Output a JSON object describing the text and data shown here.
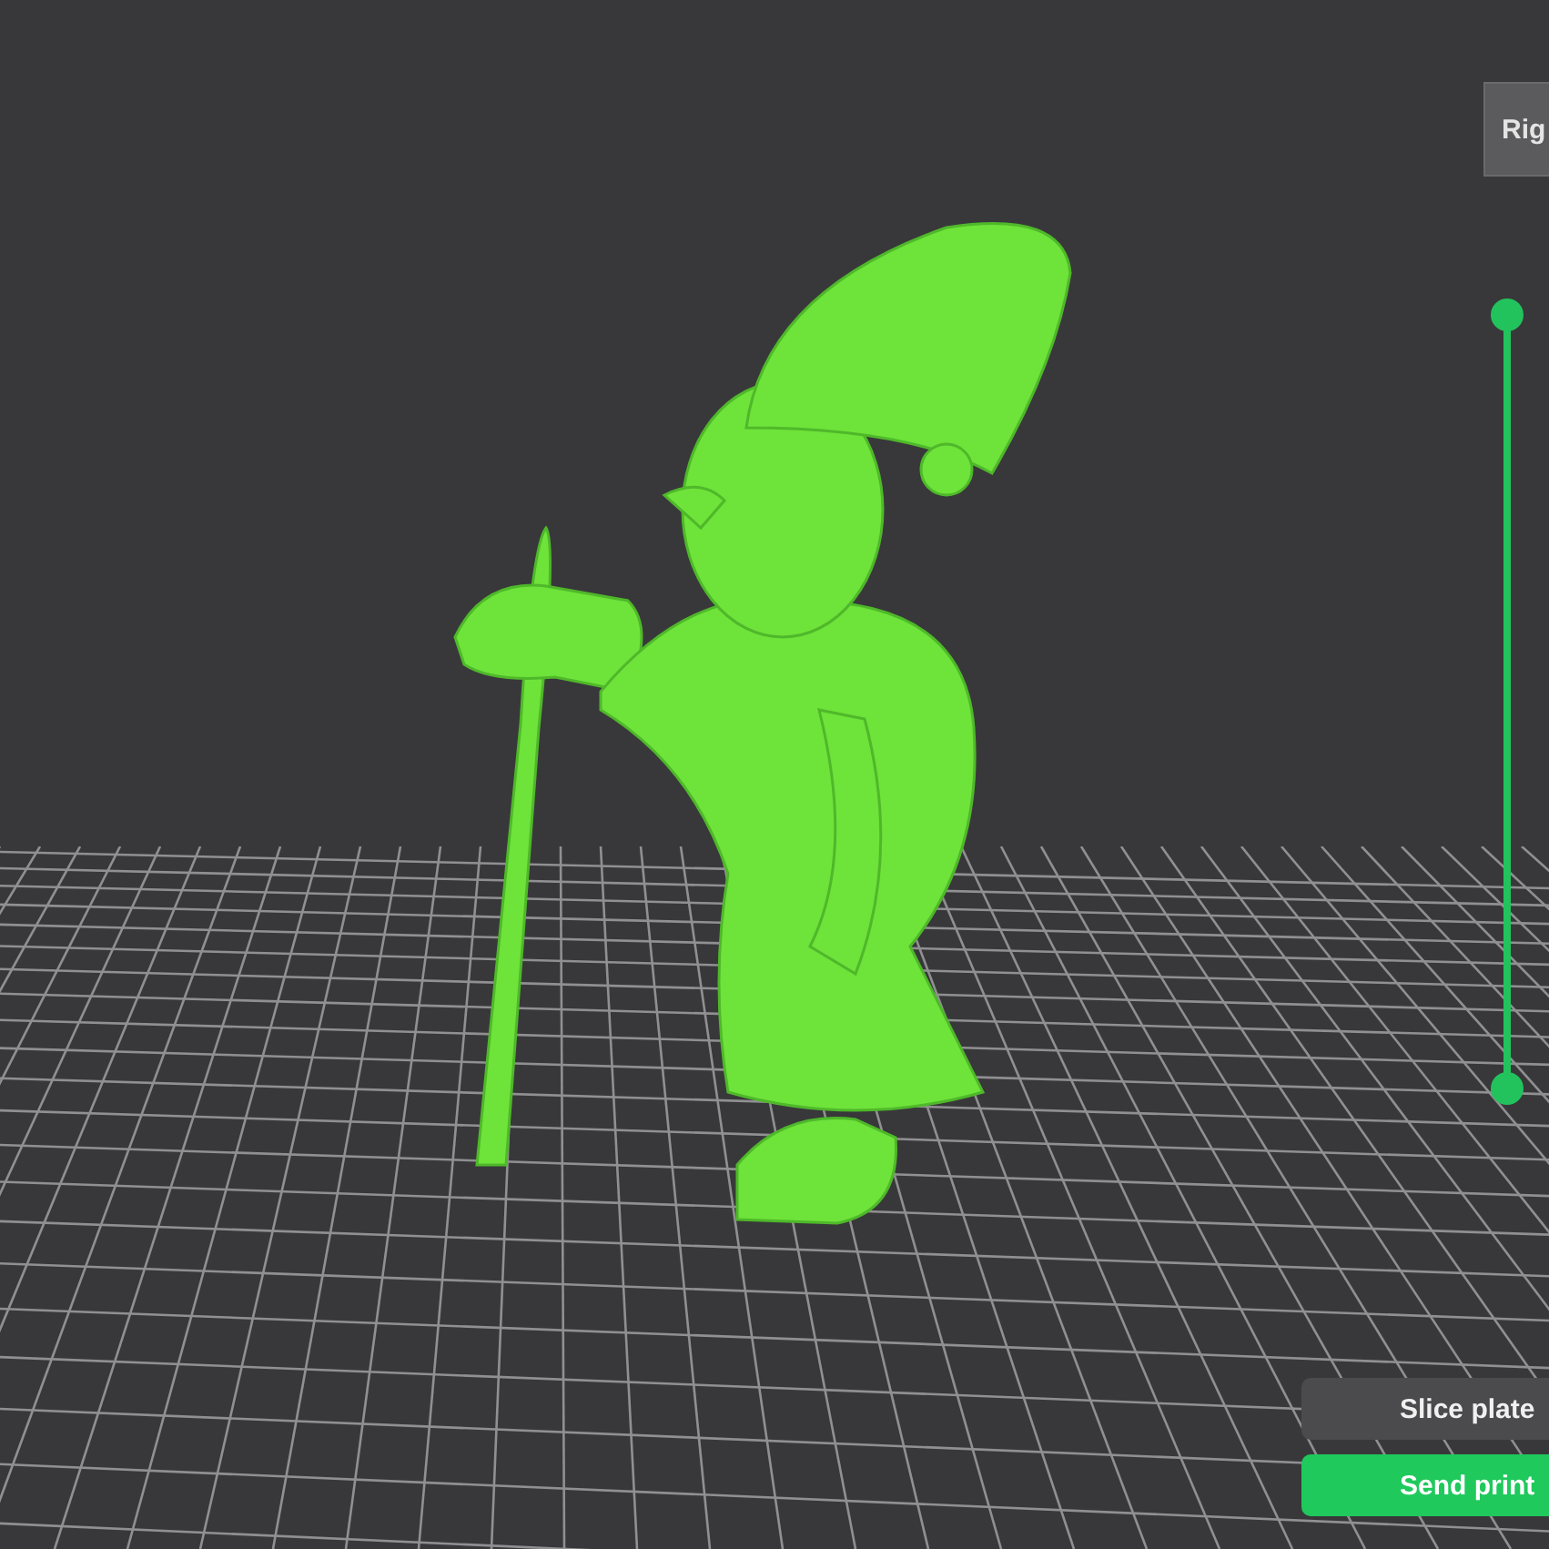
{
  "view_cube": {
    "face_label": "Rig"
  },
  "layer_slider": {
    "level": 1
  },
  "buttons": [
    {
      "kind": "secondary",
      "label": "Slice plate"
    },
    {
      "kind": "primary",
      "label": "Send print"
    }
  ]
}
